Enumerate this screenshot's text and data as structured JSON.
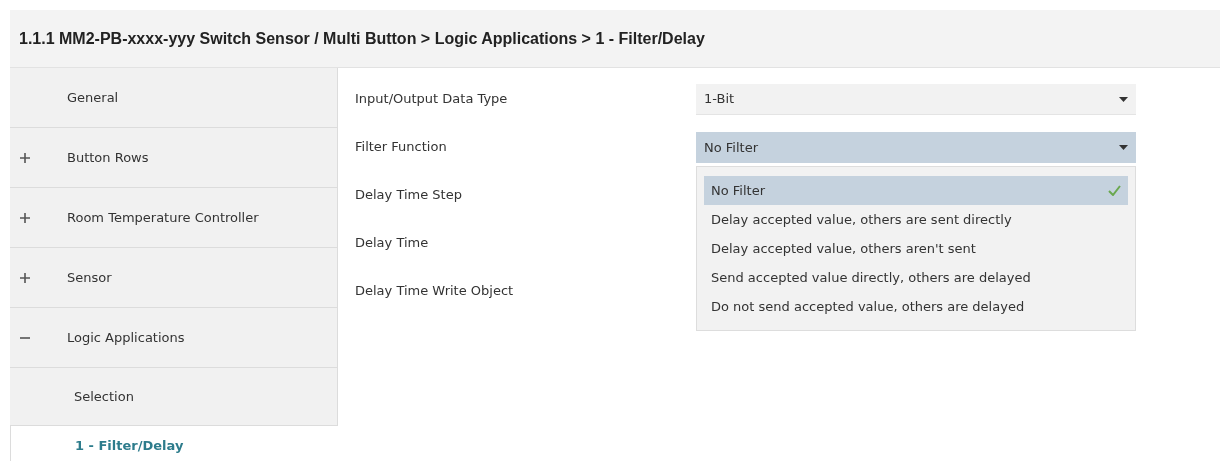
{
  "title": "1.1.1 MM2-PB-xxxx-yyy Switch Sensor / Multi Button > Logic Applications > 1 - Filter/Delay",
  "sidebar": {
    "items": [
      {
        "label": "General",
        "selected": false
      },
      {
        "label": "Button Rows",
        "selected": false,
        "expanded": false
      },
      {
        "label": "Room Temperature Controller",
        "selected": false,
        "expanded": false
      },
      {
        "label": "Sensor",
        "selected": false,
        "expanded": false
      },
      {
        "label": "Logic Applications",
        "selected": false,
        "expanded": true,
        "children": [
          {
            "label": "Selection",
            "selected": false
          },
          {
            "label": "1 - Filter/Delay",
            "selected": true
          }
        ]
      }
    ]
  },
  "parameters": [
    {
      "label": "Input/Output Data Type",
      "value": "1-Bit",
      "focused": false
    },
    {
      "label": "Filter Function",
      "value": "No Filter",
      "focused": true,
      "options": [
        {
          "label": "No Filter",
          "selected": true
        },
        {
          "label": "Delay accepted value, others are sent directly",
          "selected": false
        },
        {
          "label": "Delay accepted value, others aren't sent",
          "selected": false
        },
        {
          "label": "Send accepted value directly, others are delayed",
          "selected": false
        },
        {
          "label": "Do not send accepted value, others are delayed",
          "selected": false
        }
      ]
    },
    {
      "label": "Delay Time Step"
    },
    {
      "label": "Delay Time"
    },
    {
      "label": "Delay Time Write Object"
    }
  ]
}
